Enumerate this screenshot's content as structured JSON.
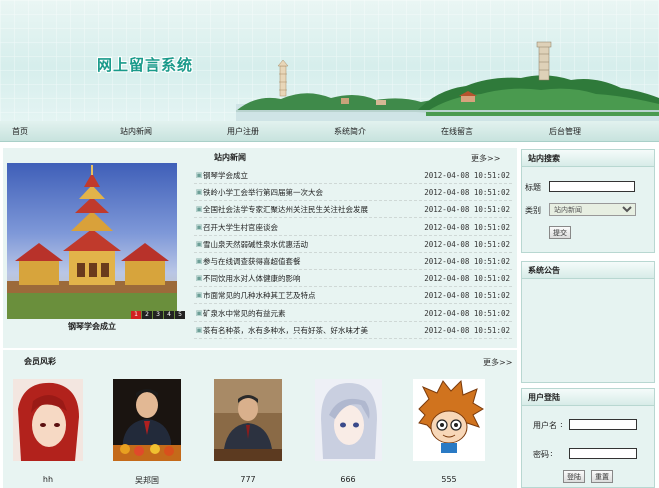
{
  "site": {
    "title": "网上留言系统"
  },
  "nav": {
    "items": [
      {
        "label": "首页"
      },
      {
        "label": "站内新闻"
      },
      {
        "label": "用户注册"
      },
      {
        "label": "系统简介"
      },
      {
        "label": "在线留言"
      },
      {
        "label": "后台管理"
      }
    ]
  },
  "news": {
    "header": "站内新闻",
    "more": "更多>>",
    "items": [
      {
        "title": "钢琴学会成立",
        "date": "2012-04-08 10:51:02"
      },
      {
        "title": "铁岭小学工会举行第四届第一次大会",
        "date": "2012-04-08 10:51:02"
      },
      {
        "title": "全国社会法学专家汇聚达州关注民生关注社会发展",
        "date": "2012-04-08 10:51:02"
      },
      {
        "title": "召开大学生村官座谈会",
        "date": "2012-04-08 10:51:02"
      },
      {
        "title": "雪山泉天然弱碱性泉水优惠活动",
        "date": "2012-04-08 10:51:02"
      },
      {
        "title": "参与在线调查获得喜超值套餐",
        "date": "2012-04-08 10:51:02"
      },
      {
        "title": "不同饮用水对人体健康的影响",
        "date": "2012-04-08 10:51:02"
      },
      {
        "title": "市面常见的几种水种其工艺及特点",
        "date": "2012-04-08 10:51:02"
      },
      {
        "title": "矿泉水中常见的有益元素",
        "date": "2012-04-08 10:51:02"
      },
      {
        "title": "茶有名种茶，水有多种水，只有好茶、好水味才美",
        "date": "2012-04-08 10:51:02"
      }
    ]
  },
  "carousel": {
    "caption": "钢琴学会成立",
    "pages": [
      "1",
      "2",
      "3",
      "4",
      "5"
    ],
    "active_index": 0
  },
  "members": {
    "header": "会员风彩",
    "more": "更多>>",
    "items": [
      {
        "name": "hh"
      },
      {
        "name": "吴邦国"
      },
      {
        "name": "777"
      },
      {
        "name": "666"
      },
      {
        "name": "555"
      }
    ]
  },
  "search": {
    "header": "站内搜索",
    "title_label": "标题",
    "title_value": "",
    "category_label": "类别",
    "category_selected": "站内新闻",
    "submit_label": "提交"
  },
  "announcement": {
    "header": "系统公告"
  },
  "login": {
    "header": "用户登陆",
    "username_label": "用户名",
    "username_value": "",
    "password_label": "密码",
    "password_value": "",
    "login_label": "登陆",
    "reset_label": "重置"
  },
  "colors": {
    "accent_teal": "#1a9a8a",
    "panel_bg": "#e8f4f2",
    "nav_bg": "#c8e3de",
    "carousel_active": "#d22020"
  }
}
